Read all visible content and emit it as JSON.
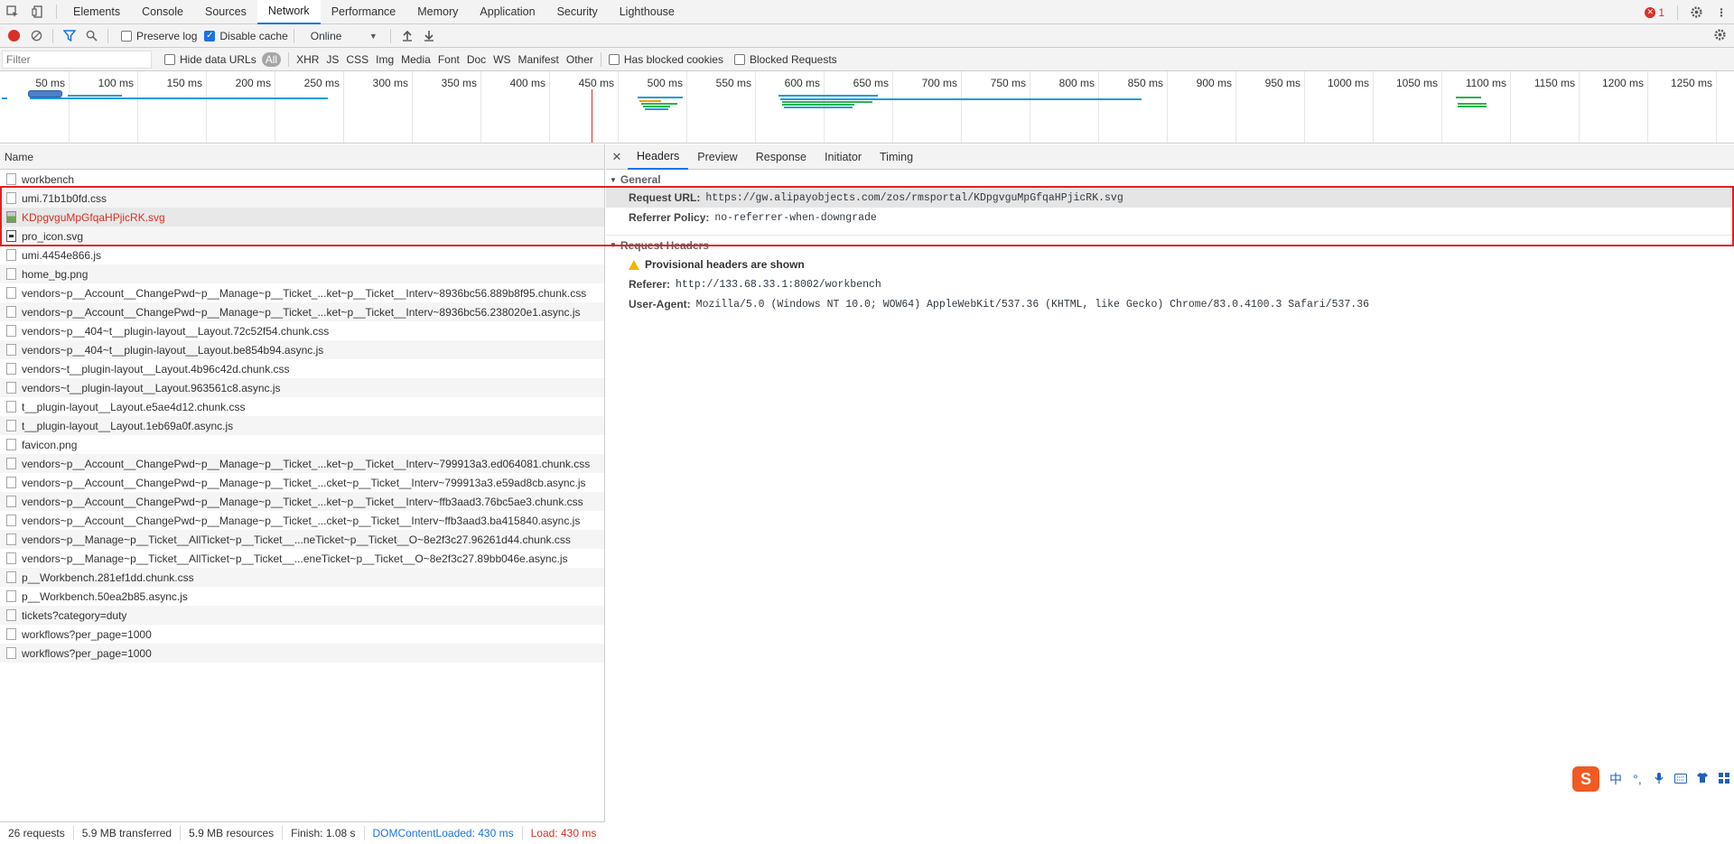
{
  "tabbar": {
    "tabs": [
      "Elements",
      "Console",
      "Sources",
      "Network",
      "Performance",
      "Memory",
      "Application",
      "Security",
      "Lighthouse"
    ],
    "active": "Network",
    "error_count": "1"
  },
  "toolbar": {
    "preserve_log": "Preserve log",
    "disable_cache": "Disable cache",
    "throttle": "Online"
  },
  "filterbar": {
    "placeholder": "Filter",
    "hide_data_urls": "Hide data URLs",
    "types": [
      "All",
      "XHR",
      "JS",
      "CSS",
      "Img",
      "Media",
      "Font",
      "Doc",
      "WS",
      "Manifest",
      "Other"
    ],
    "has_blocked_cookies": "Has blocked cookies",
    "blocked_requests": "Blocked Requests"
  },
  "overview": {
    "ticks": [
      "50 ms",
      "100 ms",
      "150 ms",
      "200 ms",
      "250 ms",
      "300 ms",
      "350 ms",
      "400 ms",
      "450 ms",
      "500 ms",
      "550 ms",
      "600 ms",
      "650 ms",
      "700 ms",
      "750 ms",
      "800 ms",
      "850 ms",
      "900 ms",
      "950 ms",
      "1000 ms",
      "1050 ms",
      "1100 ms",
      "1150 ms",
      "1200 ms",
      "1250 ms"
    ]
  },
  "requests": {
    "header": "Name",
    "rows": [
      {
        "name": "workbench",
        "icon": "doc"
      },
      {
        "name": "umi.71b1b0fd.css",
        "icon": "doc"
      },
      {
        "name": "KDpgvguMpGfqaHPjicRK.svg",
        "icon": "img",
        "error": true
      },
      {
        "name": "pro_icon.svg",
        "icon": "svg"
      },
      {
        "name": "umi.4454e866.js",
        "icon": "doc"
      },
      {
        "name": "home_bg.png",
        "icon": "doc"
      },
      {
        "name": "vendors~p__Account__ChangePwd~p__Manage~p__Ticket_...ket~p__Ticket__Interv~8936bc56.889b8f95.chunk.css",
        "icon": "doc"
      },
      {
        "name": "vendors~p__Account__ChangePwd~p__Manage~p__Ticket_...ket~p__Ticket__Interv~8936bc56.238020e1.async.js",
        "icon": "doc"
      },
      {
        "name": "vendors~p__404~t__plugin-layout__Layout.72c52f54.chunk.css",
        "icon": "doc"
      },
      {
        "name": "vendors~p__404~t__plugin-layout__Layout.be854b94.async.js",
        "icon": "doc"
      },
      {
        "name": "vendors~t__plugin-layout__Layout.4b96c42d.chunk.css",
        "icon": "doc"
      },
      {
        "name": "vendors~t__plugin-layout__Layout.963561c8.async.js",
        "icon": "doc"
      },
      {
        "name": "t__plugin-layout__Layout.e5ae4d12.chunk.css",
        "icon": "doc"
      },
      {
        "name": "t__plugin-layout__Layout.1eb69a0f.async.js",
        "icon": "doc"
      },
      {
        "name": "favicon.png",
        "icon": "doc"
      },
      {
        "name": "vendors~p__Account__ChangePwd~p__Manage~p__Ticket_...ket~p__Ticket__Interv~799913a3.ed064081.chunk.css",
        "icon": "doc"
      },
      {
        "name": "vendors~p__Account__ChangePwd~p__Manage~p__Ticket_...cket~p__Ticket__Interv~799913a3.e59ad8cb.async.js",
        "icon": "doc"
      },
      {
        "name": "vendors~p__Account__ChangePwd~p__Manage~p__Ticket_...ket~p__Ticket__Interv~ffb3aad3.76bc5ae3.chunk.css",
        "icon": "doc"
      },
      {
        "name": "vendors~p__Account__ChangePwd~p__Manage~p__Ticket_...cket~p__Ticket__Interv~ffb3aad3.ba415840.async.js",
        "icon": "doc"
      },
      {
        "name": "vendors~p__Manage~p__Ticket__AllTicket~p__Ticket__...neTicket~p__Ticket__O~8e2f3c27.96261d44.chunk.css",
        "icon": "doc"
      },
      {
        "name": "vendors~p__Manage~p__Ticket__AllTicket~p__Ticket__...eneTicket~p__Ticket__O~8e2f3c27.89bb046e.async.js",
        "icon": "doc"
      },
      {
        "name": "p__Workbench.281ef1dd.chunk.css",
        "icon": "doc"
      },
      {
        "name": "p__Workbench.50ea2b85.async.js",
        "icon": "doc"
      },
      {
        "name": "tickets?category=duty",
        "icon": "doc"
      },
      {
        "name": "workflows?per_page=1000",
        "icon": "doc"
      },
      {
        "name": "workflows?per_page=1000",
        "icon": "doc"
      }
    ]
  },
  "statusbar": {
    "requests": "26 requests",
    "transferred": "5.9 MB transferred",
    "resources": "5.9 MB resources",
    "finish": "Finish: 1.08 s",
    "dcl": "DOMContentLoaded: 430 ms",
    "load": "Load: 430 ms"
  },
  "detail": {
    "tabs": [
      "Headers",
      "Preview",
      "Response",
      "Initiator",
      "Timing"
    ],
    "active": "Headers",
    "general": {
      "title": "General",
      "request_url_label": "Request URL:",
      "request_url": "https://gw.alipayobjects.com/zos/rmsportal/KDpgvguMpGfqaHPjicRK.svg",
      "referrer_policy_label": "Referrer Policy:",
      "referrer_policy": "no-referrer-when-downgrade"
    },
    "request_headers": {
      "title": "Request Headers",
      "provisional": "Provisional headers are shown",
      "referer_label": "Referer:",
      "referer": "http://133.68.33.1:8002/workbench",
      "ua_label": "User-Agent:",
      "ua": "Mozilla/5.0 (Windows NT 10.0; WOW64) AppleWebKit/537.36 (KHTML, like Gecko) Chrome/83.0.4100.3 Safari/537.36"
    }
  },
  "ime": {
    "items": [
      "中",
      "°,",
      "mic-icon",
      "keyboard-icon",
      "shirt-icon",
      "grid-icon"
    ]
  }
}
